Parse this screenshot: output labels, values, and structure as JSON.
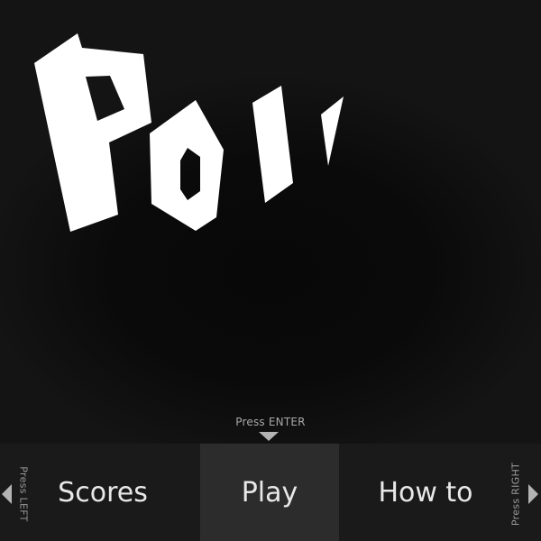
{
  "title_logo": {
    "text": "Poll",
    "color": "#ffffff"
  },
  "hints": {
    "enter": "Press ENTER",
    "left": "Press LEFT",
    "right": "Press RIGHT"
  },
  "menu": {
    "items": [
      {
        "label": "Scores"
      },
      {
        "label": "Play",
        "selected": true
      },
      {
        "label": "How to"
      }
    ]
  },
  "colors": {
    "background": "#0b0b0b",
    "menu_bar": "#1a1a1a",
    "menu_selected": "#2c2c2c",
    "menu_text": "#e8e8e8",
    "hint_text": "#a8a8a8",
    "arrows": "#b4b4b4"
  },
  "icons": {
    "enter_arrow": "triangle-down-icon",
    "left_arrow": "triangle-left-icon",
    "right_arrow": "triangle-right-icon"
  }
}
